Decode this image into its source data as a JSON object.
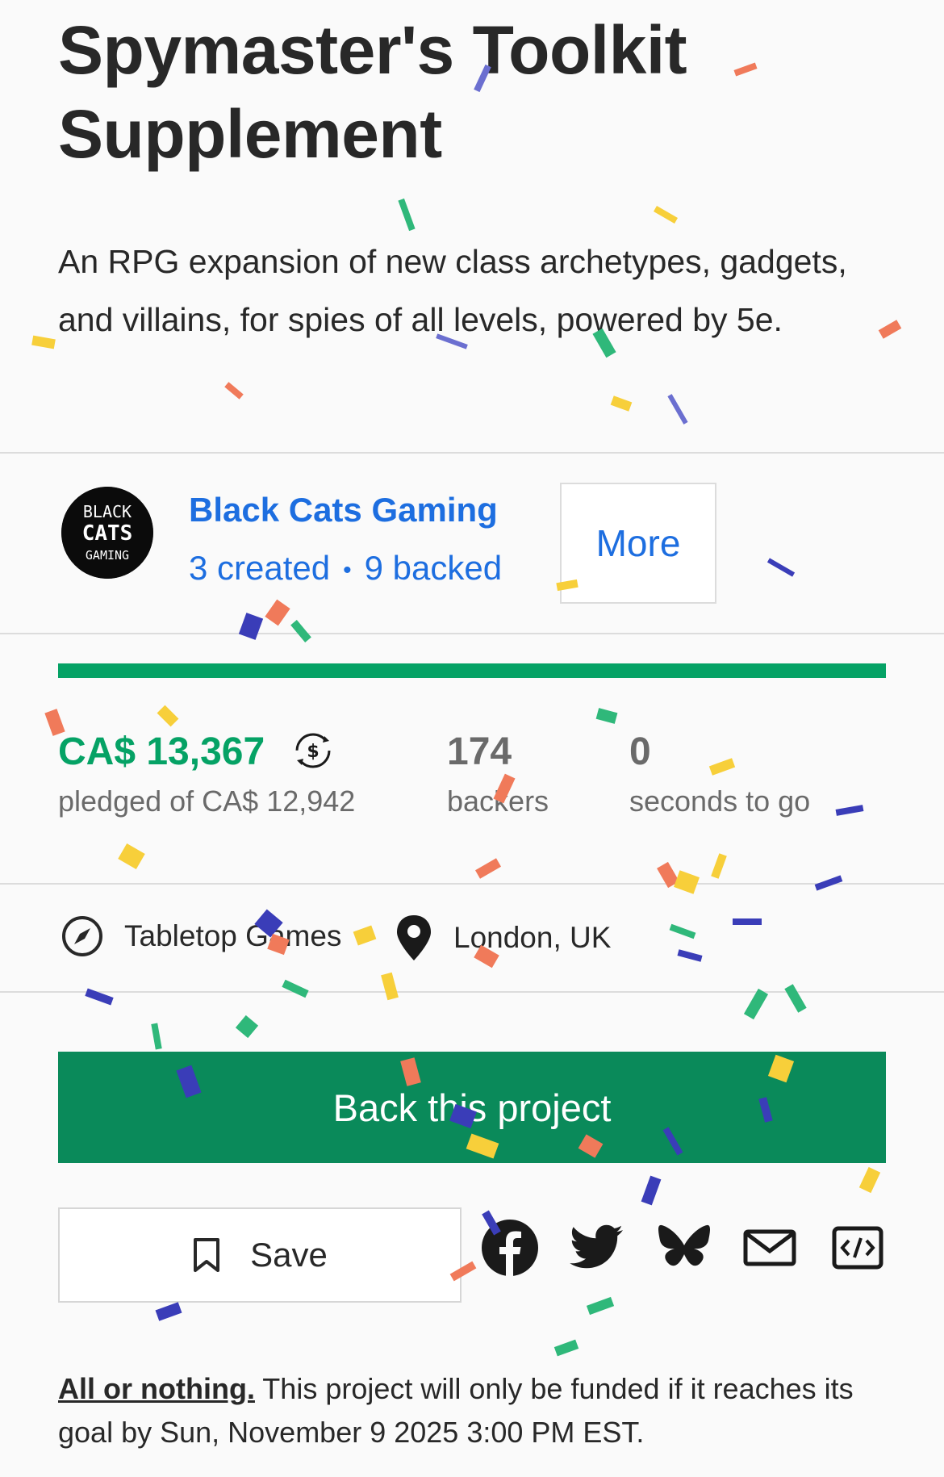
{
  "project": {
    "title": "Spymaster's Toolkit Supplement",
    "blurb": "An RPG expansion of new class archetypes, gadgets, and villains, for spies of all levels, powered by 5e."
  },
  "creator": {
    "avatar_text": [
      "BLACK",
      "CATS",
      "GAMING"
    ],
    "name": "Black Cats Gaming",
    "created": "3 created",
    "separator": "•",
    "backed": "9 backed",
    "more_label": "More"
  },
  "funding": {
    "progress_fraction": 1.0,
    "pledged": "CA$ 13,367",
    "pledged_label": "pledged of CA$ 12,942",
    "backers": "174",
    "backers_label": "backers",
    "time_left": "0",
    "time_left_label": "seconds to go",
    "colors": {
      "accent": "#05a265",
      "button": "#0a8a5a",
      "link": "#1d6ee0"
    }
  },
  "meta": {
    "category": "Tabletop Games",
    "location": "London, UK"
  },
  "actions": {
    "back_label": "Back this project",
    "save_label": "Save",
    "share_icons": [
      "facebook-icon",
      "twitter-icon",
      "bluesky-icon",
      "email-icon",
      "embed-icon"
    ]
  },
  "footer": {
    "all_or_nothing": "All or nothing.",
    "text": " This project will only be funded if it reaches its goal by Sun, November 9 2025 3:00 PM EST."
  }
}
